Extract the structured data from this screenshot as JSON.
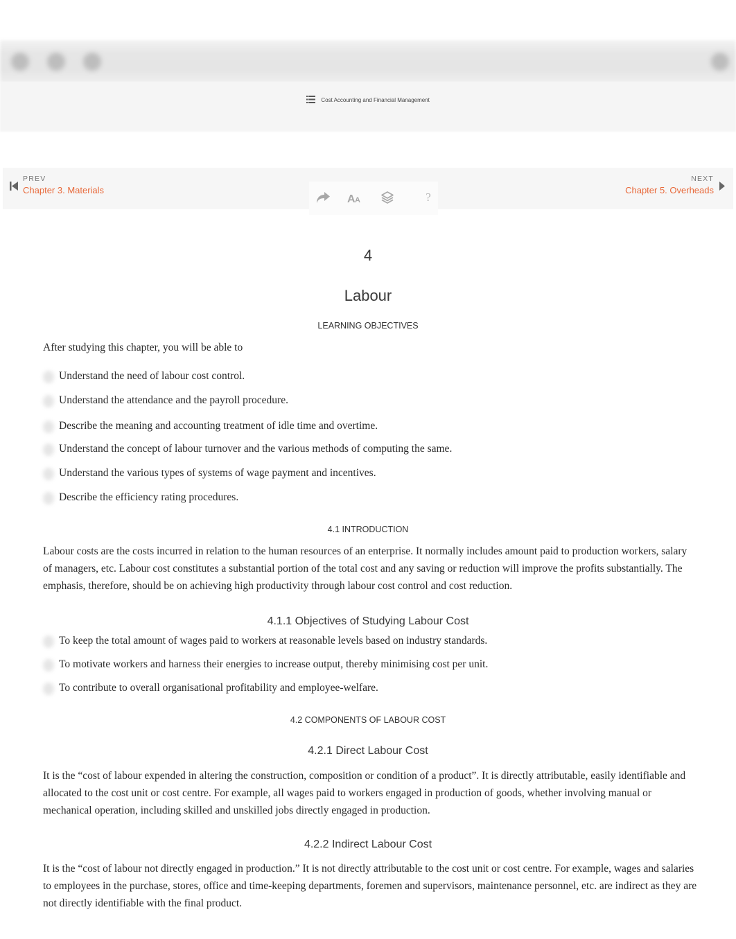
{
  "toolbar": {
    "icons": [
      "toolbar-button-1",
      "toolbar-button-2",
      "toolbar-button-3",
      "toolbar-button-right"
    ]
  },
  "toc": {
    "icon": "list-icon",
    "title": "Cost Accounting and Financial Management"
  },
  "nav": {
    "prev_label": "PREV",
    "prev_link": "Chapter 3. Materials",
    "next_label": "NEXT",
    "next_link": "Chapter 5. Overheads",
    "tools": {
      "share_icon": "share-icon",
      "font_icon": "font-size-icon",
      "layers_icon": "layers-icon",
      "help_label": "?"
    }
  },
  "chapter": {
    "number": "4",
    "title": "Labour",
    "objectives_heading": "LEARNING OBJECTIVES",
    "objectives_intro": "After studying this chapter, you will be able to",
    "objectives": [
      "Understand the need of labour cost control.",
      "Understand the attendance and the payroll procedure.",
      "Describe the meaning and accounting treatment of idle time and overtime.",
      "Understand the concept of labour turnover and the various methods of computing the same.",
      "Understand the various types of systems of wage payment and incentives.",
      "Describe the efficiency rating procedures."
    ],
    "sections": {
      "intro_heading": "4.1 INTRODUCTION",
      "intro_text": "Labour costs are the costs incurred in relation to the human resources of an enterprise. It normally includes amount paid to production workers, salary of managers, etc. Labour cost constitutes a substantial portion of the total cost and any saving or reduction will improve the profits substantially. The emphasis, therefore, should be on achieving high productivity through labour cost control and cost reduction.",
      "objectives_sub_heading": "4.1.1 Objectives of Studying Labour Cost",
      "objectives_sub": [
        "To keep the total amount of wages paid to workers at reasonable levels based on industry standards.",
        "To motivate workers and harness their energies to increase output, thereby minimising cost per unit.",
        "To contribute to overall organisational profitability and employee-welfare."
      ],
      "components_heading": "4.2 COMPONENTS OF LABOUR COST",
      "direct_heading": "4.2.1 Direct Labour Cost",
      "direct_text": "It is the “cost of labour expended in altering the construction, composition or condition of a product”. It is directly attributable, easily iden­tifiable and allocated to the cost unit or cost centre. For example, all wages paid to workers engaged in production of goods, whether in­volving manual or mechanical operation, including skilled and unskilled jobs directly engaged in production.",
      "indirect_heading": "4.2.2 Indirect Labour Cost",
      "indirect_text": "It is the “cost of labour not directly engaged in production.” It is not directly attributable to the cost unit or cost centre. For example, wages and salaries to employees in the purchase, stores, office and time-keeping departments, foremen and supervisors, maintenance personnel, etc. are indirect as they are not directly identifiable with the final product."
    }
  },
  "colors": {
    "accent": "#e8693a",
    "text": "#2b2b2b",
    "muted": "#777777"
  }
}
